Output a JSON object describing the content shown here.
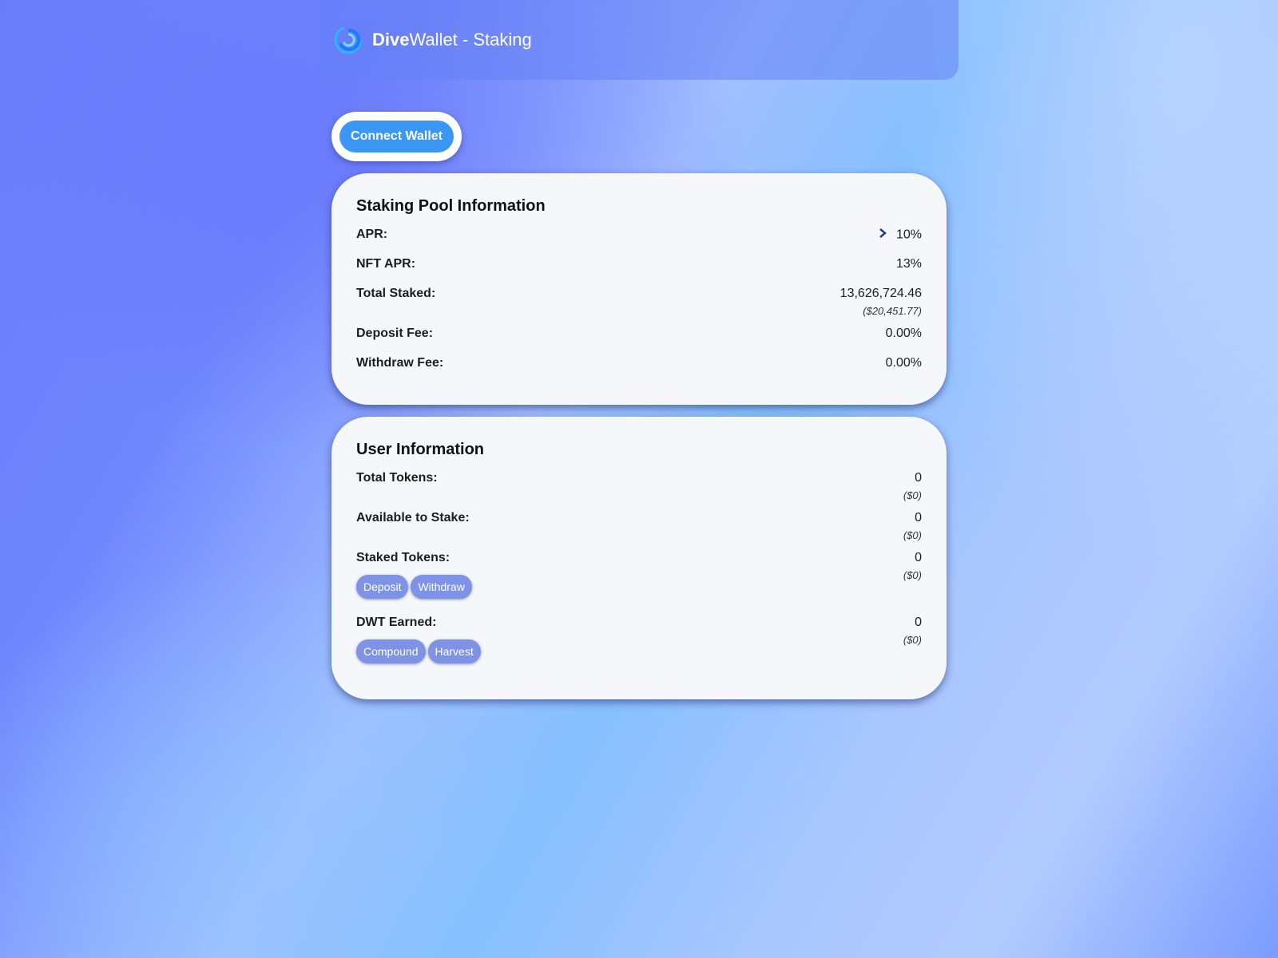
{
  "header": {
    "brand_bold": "Dive",
    "brand_rest": "Wallet - Staking",
    "logo_icon": "swirl-logo-icon"
  },
  "connect": {
    "label": "Connect Wallet"
  },
  "pool": {
    "title": "Staking Pool Information",
    "apr_label": "APR:",
    "apr_value": "10%",
    "nft_apr_label": "NFT APR:",
    "nft_apr_value": "13%",
    "total_staked_label": "Total Staked:",
    "total_staked_value": "13,626,724.46",
    "total_staked_usd": "($20,451.77)",
    "deposit_fee_label": "Deposit Fee:",
    "deposit_fee_value": "0.00%",
    "withdraw_fee_label": "Withdraw Fee:",
    "withdraw_fee_value": "0.00%"
  },
  "user": {
    "title": "User Information",
    "total_tokens_label": "Total Tokens:",
    "total_tokens_value": "0",
    "total_tokens_usd": "($0)",
    "available_label": "Available to Stake:",
    "available_value": "0",
    "available_usd": "($0)",
    "staked_label": "Staked Tokens:",
    "staked_value": "0",
    "staked_usd": "($0)",
    "deposit_btn": "Deposit",
    "withdraw_btn": "Withdraw",
    "earned_label": "DWT Earned:",
    "earned_value": "0",
    "earned_usd": "($0)",
    "compound_btn": "Compound",
    "harvest_btn": "Harvest"
  },
  "colors": {
    "accent": "#3a97f5",
    "pill": "#7e93e6",
    "card": "#f6f7fa"
  }
}
